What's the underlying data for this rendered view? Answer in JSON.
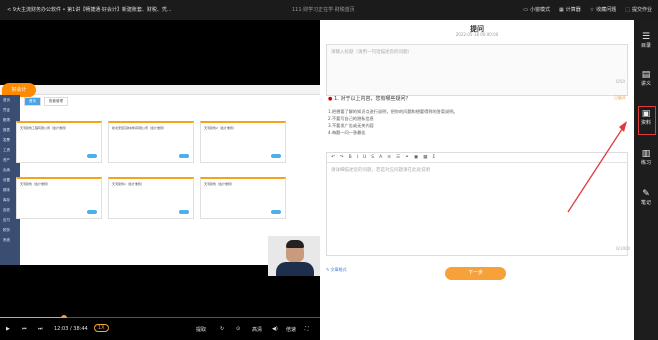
{
  "top_bar": {
    "title": "< 9大主流财务办公软件 • 第1讲【畅捷通·好会计】新建账套、财税、凭...",
    "center": "111·财学习正在学·财税首页",
    "actions": [
      "小窗模式",
      "计算器",
      "收藏问题",
      "提交作业"
    ]
  },
  "software": {
    "logo": "好会计",
    "sidebar": [
      "首页",
      "凭证",
      "账簿",
      "报表",
      "发票",
      "工资",
      "资产",
      "出纳",
      "设置",
      "期末",
      "库存",
      "应收",
      "应付",
      "税务",
      "系统"
    ],
    "tabs": [
      "首页",
      "账套管理"
    ],
    "cards": [
      {
        "name": "天河建筑工程有限公司",
        "sub": "（会计准则）"
      },
      {
        "name": "新北安控高新材料有限公司",
        "sub": "（会计准则）"
      },
      {
        "name": "天河建筑2",
        "sub": "（会计准则）"
      },
      {
        "name": "天河建筑",
        "sub": "（会计准则）"
      },
      {
        "name": "天河建筑1",
        "sub": "（会计准则）"
      },
      {
        "name": "天河建筑",
        "sub": "（会计准则）"
      }
    ]
  },
  "player": {
    "time": "12:03 / 38:44",
    "rate": "1X",
    "buttons": [
      "提取",
      "高清",
      "倍速"
    ],
    "progress": 0.31
  },
  "question_panel": {
    "title": "提问",
    "meta": "2022-05-18 00:00:00",
    "box_placeholder": "请输入标题（请用一句话描述您的问题）",
    "box_counter": "0/50",
    "q_title": "1. 对于以上内容，您有哪些疑问？",
    "unfold": "已展开",
    "q_text": [
      "1.把想要了解的知识点进行说明，把你的问题和想要得到的答案说明。",
      "2.不要写自己的隐私信息",
      "3.不要发广告或无关内容",
      "4.每题一问一答最佳"
    ],
    "editor_placeholder": "请详细描述您的问题，若是对应问题请在此处说明",
    "editor_counter": "0/1000",
    "fmt_note": "文章格式",
    "next_button": "下一步"
  },
  "right_rail": [
    {
      "icon": "list-icon",
      "label": "目录"
    },
    {
      "icon": "document-icon",
      "label": "讲义"
    },
    {
      "icon": "lock-doc-icon",
      "label": "资料"
    },
    {
      "icon": "notebook-icon",
      "label": "练习"
    },
    {
      "icon": "pen-icon",
      "label": "笔记"
    }
  ]
}
